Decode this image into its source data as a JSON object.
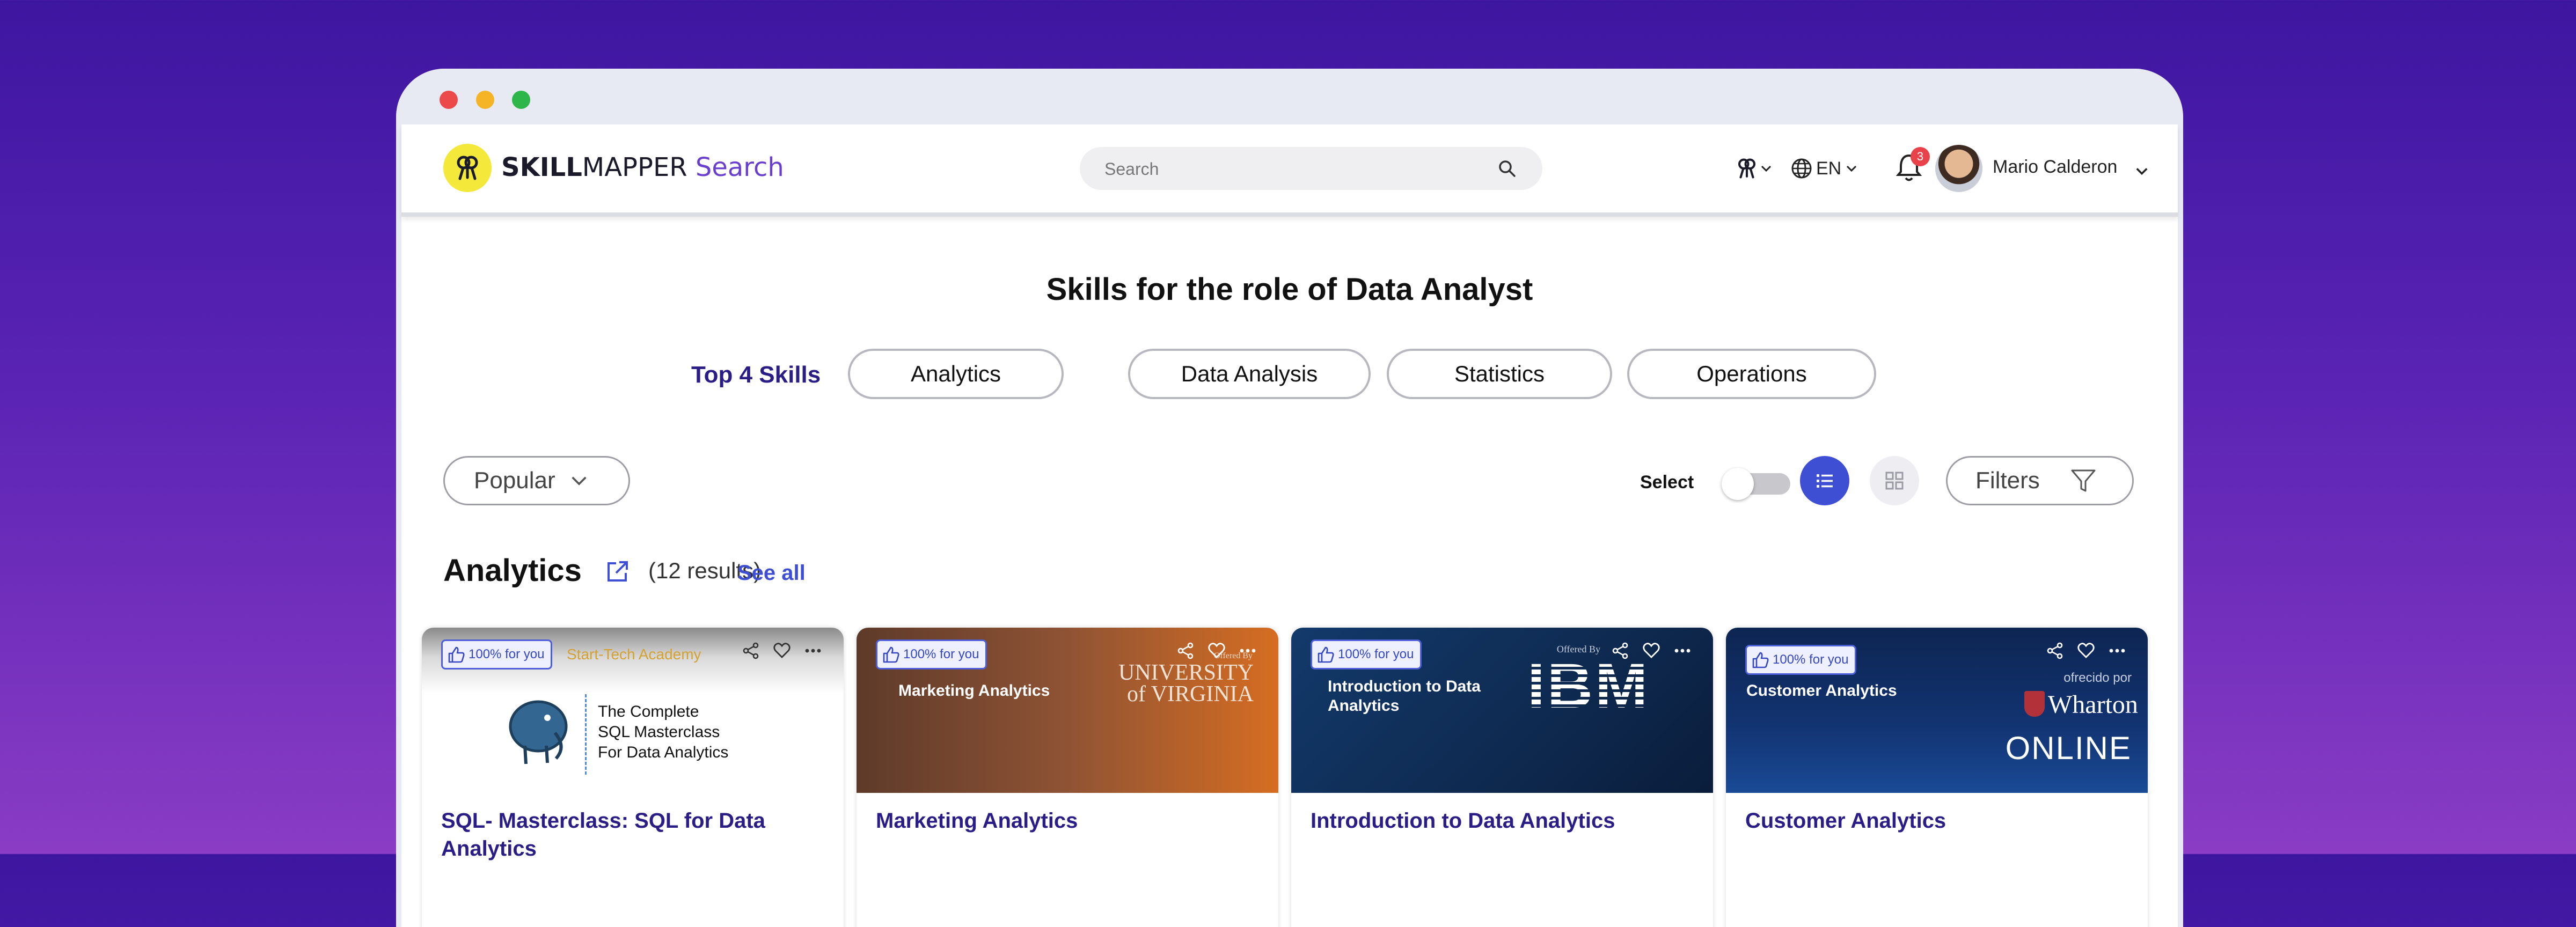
{
  "app": {
    "brand_bold": "SKILL",
    "brand_thin": "MAPPER",
    "brand_accent": "Search",
    "search_placeholder": "Search",
    "language": "EN",
    "notification_count": "3",
    "user_name": "Mario Calderon",
    "accent_color": "#3e4fd4"
  },
  "page": {
    "title": "Skills for the role of Data Analyst",
    "top_skills_label": "Top 4 Skills",
    "skills": [
      "Analytics",
      "Data Analysis",
      "Statistics",
      "Operations"
    ],
    "sort_value": "Popular",
    "select_label": "Select",
    "filters_label": "Filters"
  },
  "section": {
    "title": "Analytics",
    "results": "(12 results)",
    "see_all": "See all"
  },
  "cards": [
    {
      "match": "100% for you",
      "provider": "Start-Tech Academy",
      "banner_lines": [
        "The Complete",
        "SQL Masterclass",
        "For Data Analytics"
      ],
      "title": "SQL- Masterclass: SQL for Data Analytics"
    },
    {
      "match": "100% for you",
      "provider_small": "Offered By",
      "provider": "UNIVERSITY of VIRGINIA",
      "banner_title": "Marketing Analytics",
      "title": "Marketing Analytics"
    },
    {
      "match": "100% for you",
      "provider_small": "Offered By",
      "provider": "IBM",
      "banner_title": "Introduction to Data Analytics",
      "title": "Introduction to Data Analytics"
    },
    {
      "match": "100% for you",
      "provider_small": "ofrecido por",
      "provider": "Wharton",
      "provider_sub": "ONLINE",
      "banner_title": "Customer Analytics",
      "title": "Customer Analytics"
    }
  ]
}
